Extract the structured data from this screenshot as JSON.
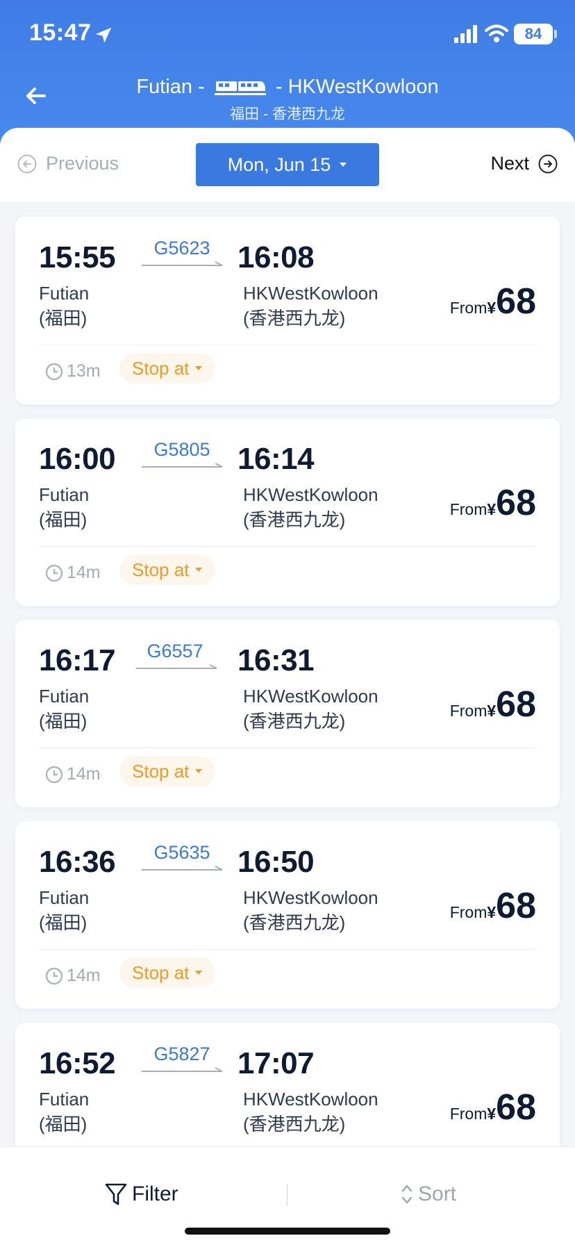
{
  "status_bar": {
    "time": "15:47",
    "battery": "84"
  },
  "header": {
    "origin": "Futian",
    "destination": "HKWestKowloon",
    "dash_left": "-",
    "dash_right": "-",
    "subtitle": "福田 - 香港西九龙"
  },
  "date_bar": {
    "previous_label": "Previous",
    "date_label": "Mon, Jun 15",
    "next_label": "Next"
  },
  "trains": [
    {
      "dep_time": "15:55",
      "train_no": "G5623",
      "arr_time": "16:08",
      "dep_station": "Futian",
      "dep_station_cn": "(福田)",
      "arr_station": "HKWestKowloon",
      "arr_station_cn": "(香港西九龙)",
      "price_prefix": "From",
      "currency": "¥",
      "price": "68",
      "duration": "13m",
      "stop_label": "Stop at"
    },
    {
      "dep_time": "16:00",
      "train_no": "G5805",
      "arr_time": "16:14",
      "dep_station": "Futian",
      "dep_station_cn": "(福田)",
      "arr_station": "HKWestKowloon",
      "arr_station_cn": "(香港西九龙)",
      "price_prefix": "From",
      "currency": "¥",
      "price": "68",
      "duration": "14m",
      "stop_label": "Stop at"
    },
    {
      "dep_time": "16:17",
      "train_no": "G6557",
      "arr_time": "16:31",
      "dep_station": "Futian",
      "dep_station_cn": "(福田)",
      "arr_station": "HKWestKowloon",
      "arr_station_cn": "(香港西九龙)",
      "price_prefix": "From",
      "currency": "¥",
      "price": "68",
      "duration": "14m",
      "stop_label": "Stop at"
    },
    {
      "dep_time": "16:36",
      "train_no": "G5635",
      "arr_time": "16:50",
      "dep_station": "Futian",
      "dep_station_cn": "(福田)",
      "arr_station": "HKWestKowloon",
      "arr_station_cn": "(香港西九龙)",
      "price_prefix": "From",
      "currency": "¥",
      "price": "68",
      "duration": "14m",
      "stop_label": "Stop at"
    },
    {
      "dep_time": "16:52",
      "train_no": "G5827",
      "arr_time": "17:07",
      "dep_station": "Futian",
      "dep_station_cn": "(福田)",
      "arr_station": "HKWestKowloon",
      "arr_station_cn": "(香港西九龙)",
      "price_prefix": "From",
      "currency": "¥",
      "price": "68",
      "duration": "",
      "stop_label": ""
    }
  ],
  "bottom_bar": {
    "filter_label": "Filter",
    "sort_label": "Sort"
  },
  "icons": {
    "back": "back-arrow-icon",
    "train": "train-icon",
    "previous": "circle-left-arrow-icon",
    "next": "circle-right-arrow-icon",
    "clock": "clock-icon",
    "filter": "funnel-icon",
    "sort": "up-down-chevron-icon"
  },
  "colors": {
    "header_blue": "#3f7de6",
    "date_button": "#3a7ae0",
    "train_no": "#3a7ad4",
    "stop_orange": "#ee9a25"
  }
}
